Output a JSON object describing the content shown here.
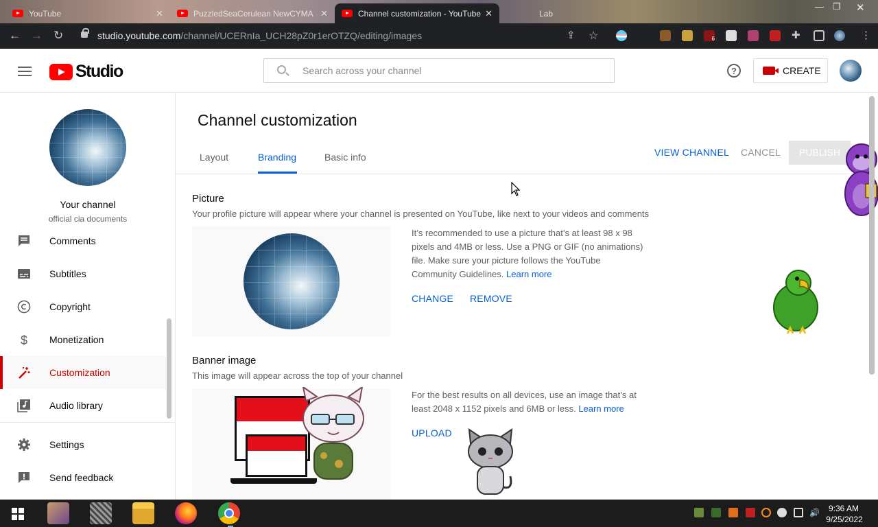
{
  "browser": {
    "tabs": [
      {
        "title": "YouTube",
        "active": false
      },
      {
        "title": "PuzzledSeaCerulean NewCYMA",
        "active": false
      },
      {
        "title": "Channel customization - YouTube",
        "active": true
      },
      {
        "title": "Lab",
        "active": false
      }
    ],
    "url_host": "studio.youtube.com",
    "url_path": "/channel/UCERnIa_UCH28pZ0r1erOTZQ/editing/images",
    "extension_badge": "6"
  },
  "header": {
    "logo_text": "Studio",
    "search_placeholder": "Search across your channel",
    "create_label": "CREATE"
  },
  "sidebar": {
    "your_channel": "Your channel",
    "channel_name": "official cia documents",
    "items": [
      {
        "label": "Comments",
        "icon": "comment-icon"
      },
      {
        "label": "Subtitles",
        "icon": "subtitles-icon"
      },
      {
        "label": "Copyright",
        "icon": "copyright-icon"
      },
      {
        "label": "Monetization",
        "icon": "dollar-icon"
      },
      {
        "label": "Customization",
        "icon": "magic-wand-icon",
        "active": true
      },
      {
        "label": "Audio library",
        "icon": "audio-library-icon"
      },
      {
        "label": "Settings",
        "icon": "gear-icon"
      },
      {
        "label": "Send feedback",
        "icon": "feedback-icon"
      }
    ]
  },
  "main": {
    "title": "Channel customization",
    "tabs": [
      {
        "label": "Layout"
      },
      {
        "label": "Branding",
        "active": true
      },
      {
        "label": "Basic info"
      }
    ],
    "view_channel": "VIEW CHANNEL",
    "cancel": "CANCEL",
    "publish": "PUBLISH",
    "picture": {
      "title": "Picture",
      "description": "Your profile picture will appear where your channel is presented on YouTube, like next to your videos and comments",
      "info": "It’s recommended to use a picture that’s at least 98 x 98 pixels and 4MB or less. Use a PNG or GIF (no animations) file. Make sure your picture follows the YouTube Community Guidelines.",
      "learn_more": "Learn more",
      "change": "CHANGE",
      "remove": "REMOVE"
    },
    "banner": {
      "title": "Banner image",
      "description": "This image will appear across the top of your channel",
      "info": "For the best results on all devices, use an image that’s at least 2048 x 1152 pixels and 6MB or less.",
      "learn_more": "Learn more",
      "upload": "UPLOAD"
    }
  },
  "taskbar": {
    "time": "9:36 AM",
    "date": "9/25/2022"
  },
  "colors": {
    "accent_blue": "#065fd4",
    "brand_red": "#ff0000",
    "active_red": "#cc0000"
  }
}
